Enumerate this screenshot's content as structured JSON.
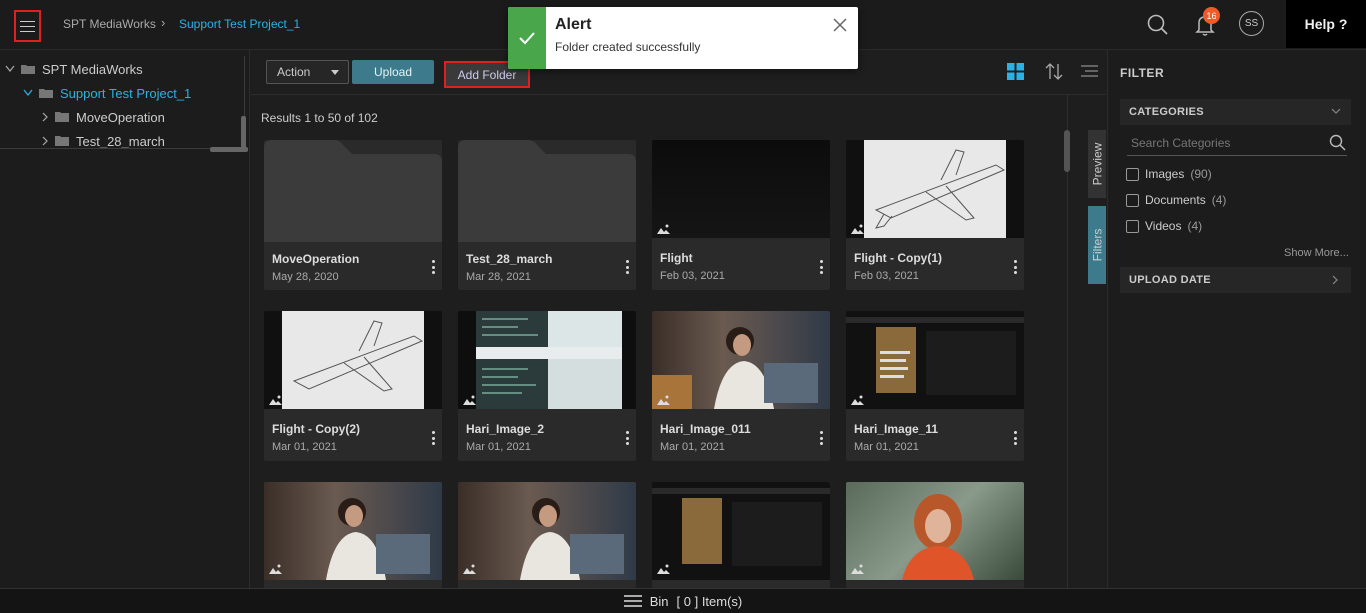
{
  "header": {
    "breadcrumb_root": "SPT MediaWorks",
    "breadcrumb_current": "Support Test Project_1",
    "notification_count": "16",
    "user_initials": "SS",
    "help_label": "Help ?"
  },
  "alert": {
    "title": "Alert",
    "message": "Folder created successfully"
  },
  "tree": {
    "root": "SPT MediaWorks",
    "project": "Support Test Project_1",
    "children": [
      "MoveOperation",
      "Test_28_march"
    ]
  },
  "toolbar": {
    "action_label": "Action",
    "upload_label": "Upload",
    "add_folder_label": "Add Folder"
  },
  "results_text": "Results 1 to 50 of 102",
  "cards": [
    {
      "name": "MoveOperation",
      "date": "May 28, 2020",
      "kind": "folder"
    },
    {
      "name": "Test_28_march",
      "date": "Mar 28, 2021",
      "kind": "folder"
    },
    {
      "name": "Flight",
      "date": "Feb 03, 2021",
      "kind": "image"
    },
    {
      "name": "Flight - Copy(1)",
      "date": "Feb 03, 2021",
      "kind": "image"
    },
    {
      "name": "Flight - Copy(2)",
      "date": "Mar 01, 2021",
      "kind": "image"
    },
    {
      "name": "Hari_Image_2",
      "date": "Mar 01, 2021",
      "kind": "image"
    },
    {
      "name": "Hari_Image_011",
      "date": "Mar 01, 2021",
      "kind": "image"
    },
    {
      "name": "Hari_Image_11",
      "date": "Mar 01, 2021",
      "kind": "image"
    }
  ],
  "side_tabs": {
    "preview": "Preview",
    "filters": "Filters"
  },
  "filter": {
    "title": "FILTER",
    "categories_label": "CATEGORIES",
    "search_placeholder": "Search Categories",
    "options": [
      {
        "label": "Images",
        "count": "(90)"
      },
      {
        "label": "Documents",
        "count": "(4)"
      },
      {
        "label": "Videos",
        "count": "(4)"
      }
    ],
    "show_more": "Show More...",
    "upload_date_label": "UPLOAD DATE"
  },
  "bottom": {
    "bin_label": "Bin",
    "items_text": "[ 0 ] Item(s)"
  },
  "colors": {
    "accent": "#2ab2e6",
    "teal": "#3c7a8c",
    "alert_green": "#4aa64a",
    "badge": "#f05a28"
  }
}
